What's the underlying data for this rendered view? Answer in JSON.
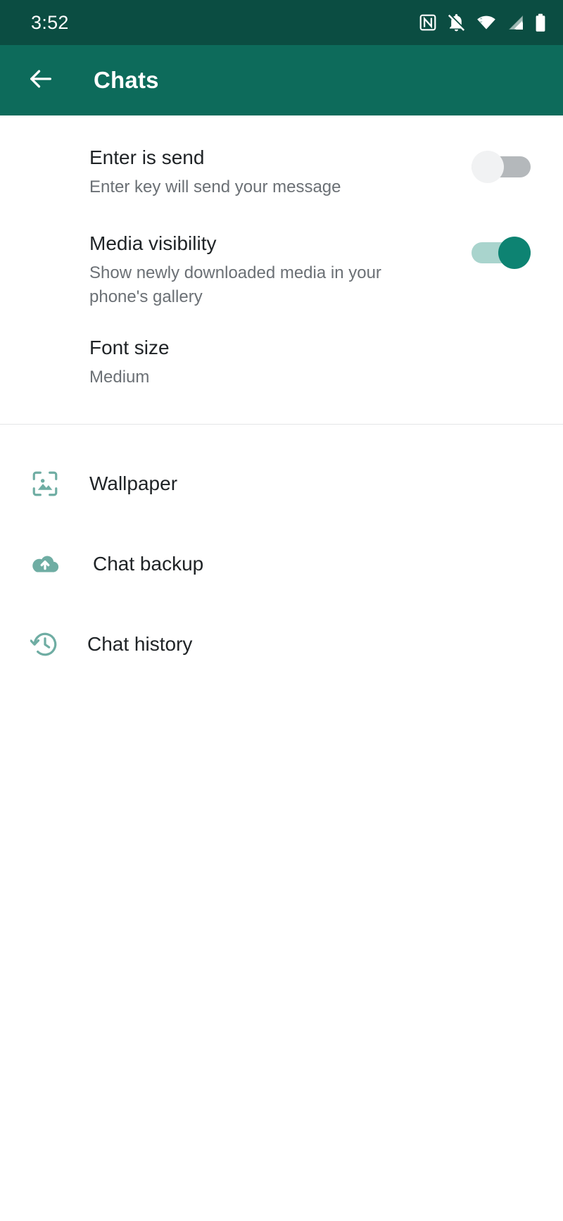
{
  "status_bar": {
    "time": "3:52",
    "icons": [
      "nfc-icon",
      "notifications-off-icon",
      "wifi-icon",
      "cellular-signal-icon",
      "battery-icon"
    ],
    "background": "#0b4d42"
  },
  "app_bar": {
    "title": "Chats",
    "back_icon": "back-arrow-icon",
    "background": "#0d6b5b"
  },
  "settings": {
    "enter_is_send": {
      "title": "Enter is send",
      "subtitle": "Enter key will send your message",
      "toggle_state": "off"
    },
    "media_visibility": {
      "title": "Media visibility",
      "subtitle": "Show newly downloaded media in your phone's gallery",
      "toggle_state": "on"
    },
    "font_size": {
      "title": "Font size",
      "value": "Medium"
    }
  },
  "nav_items": [
    {
      "label": "Wallpaper",
      "icon": "wallpaper-icon"
    },
    {
      "label": "Chat backup",
      "icon": "cloud-upload-icon"
    },
    {
      "label": "Chat history",
      "icon": "history-clock-icon"
    }
  ],
  "colors": {
    "status_bar": "#0b4d42",
    "app_bar": "#0d6b5b",
    "accent_teal": "#0d8372",
    "icon_teal": "#6fada3",
    "toggle_on_track": "#a9d4cd",
    "toggle_off_track": "#b4b8bb",
    "title_text": "#1f2326",
    "secondary_text": "#6b7075",
    "divider": "#e4e6e7",
    "page_background": "#ffffff"
  }
}
